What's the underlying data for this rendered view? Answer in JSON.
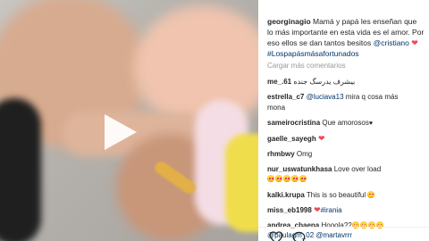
{
  "post": {
    "author": "georginagio",
    "caption_text": " Mamá y papá les enseñan que lo más importante en esta vida es el amor. Por eso ellos se dan tantos besitos ",
    "caption_mention": "@cristiano",
    "caption_hashtag": "#Lospapásmásafortunados"
  },
  "load_more": "Cargar más comentarios",
  "comments": [
    {
      "user": "me_.61",
      "text": "بيشرف يدرسگ جنده"
    },
    {
      "user": "estrella_c7",
      "text": " mira q cosa más",
      "mention": "@luciava13",
      "text2": "mona"
    },
    {
      "user": "sameirocristina",
      "text": " Que amorosos"
    },
    {
      "user": "gaelle_sayegh",
      "text": ""
    },
    {
      "user": "rhmbwy",
      "text": " Omg"
    },
    {
      "user": "nur_uswatunkhasa",
      "text": " Love over load"
    },
    {
      "user": "kalki.krupa",
      "text": " This is so beautiful "
    },
    {
      "user": "miss_eb1998",
      "text": "",
      "hashtag": "#irania"
    },
    {
      "user": "andrea_cbaena",
      "text": " Hooola??",
      "mention": "@paulagm_02 @martavrrr"
    }
  ],
  "icons": {
    "like": "heart-outline-icon",
    "comment": "comment-bubble-icon",
    "play": "play-icon"
  },
  "colors": {
    "link": "#003569",
    "heart": "#ed4956",
    "muted": "#999999"
  }
}
